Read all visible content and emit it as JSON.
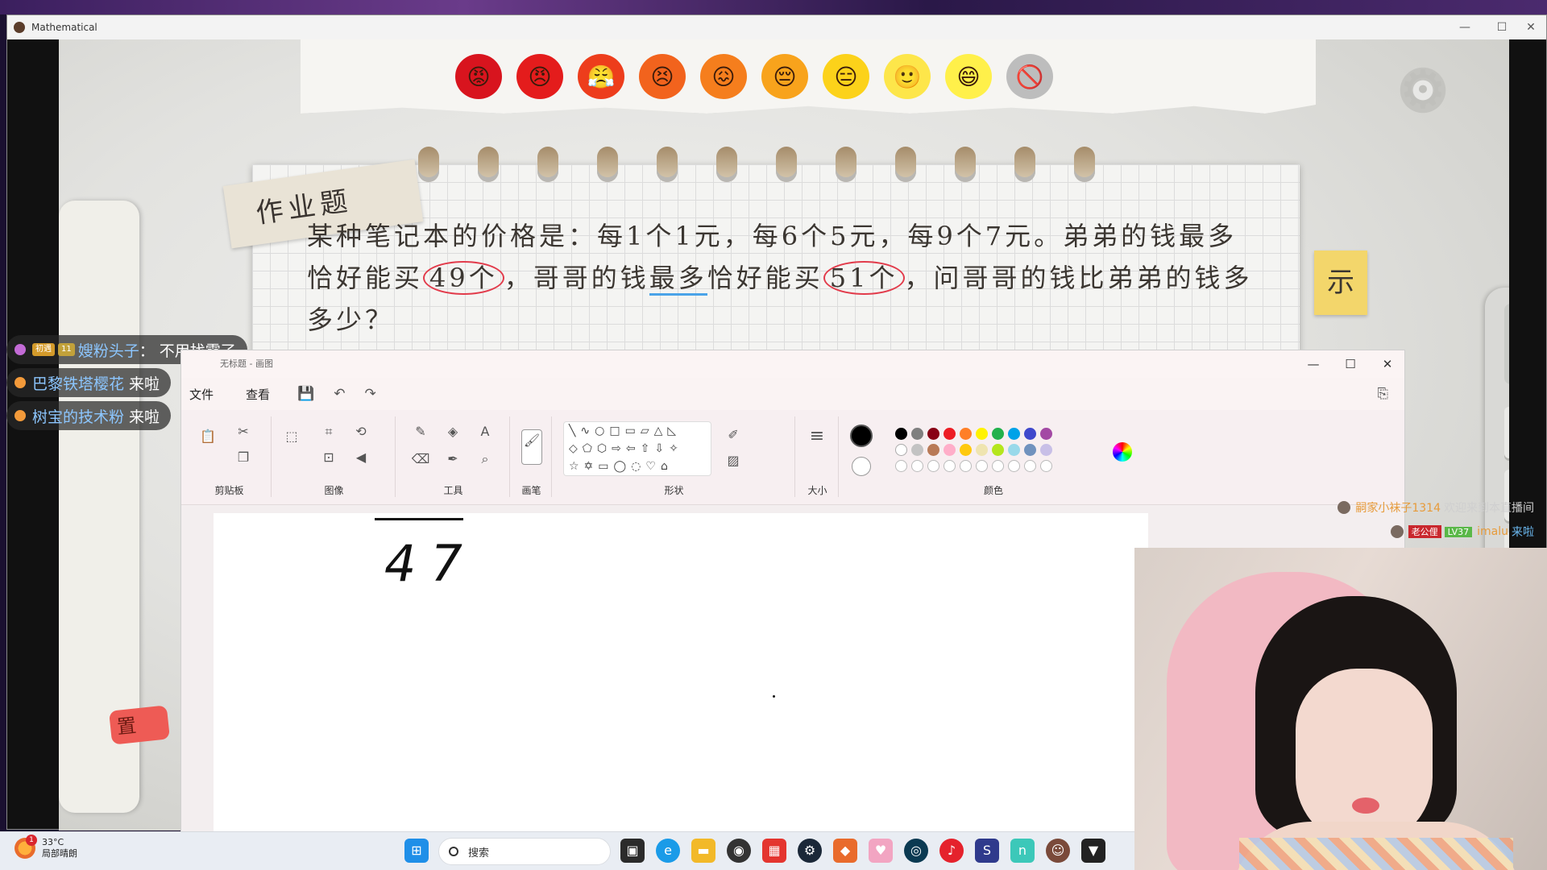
{
  "game": {
    "title": "Mathematical",
    "controls": [
      "—",
      "☐",
      "✕"
    ],
    "emojis": [
      {
        "face": "😡",
        "color": "#d8141e"
      },
      {
        "face": "😠",
        "color": "#e41c1c"
      },
      {
        "face": "😤",
        "color": "#ed3d1c"
      },
      {
        "face": "😣",
        "color": "#f2631d"
      },
      {
        "face": "😖",
        "color": "#f57e1d"
      },
      {
        "face": "😔",
        "color": "#f8a31c"
      },
      {
        "face": "😑",
        "color": "#fcd21a"
      },
      {
        "face": "🙂",
        "color": "#fde64a"
      },
      {
        "face": "😄",
        "color": "#fff04a"
      },
      {
        "face": "🚫",
        "color": "#bdbdbd"
      }
    ],
    "homework_tag": "作业题",
    "problem": {
      "line1": "某种笔记本的价格是：每1个1元，每6个5元，每9个7元。弟弟的钱最多",
      "line2_a": "恰好能买",
      "line2_circle1": "49个",
      "line2_b": "，哥哥的钱",
      "line2_underline": "最多",
      "line2_c": "恰好能买",
      "line2_circle2": "51个",
      "line2_d": "，问哥哥的钱比弟弟的钱多",
      "line3": "多少？"
    },
    "hint_label": "示",
    "stamp_label": "置",
    "calculator_keys": [
      "+",
      "7",
      "4"
    ]
  },
  "chat": [
    {
      "name": "嫂粉头子",
      "sep": "：",
      "msg": "不用找零了",
      "badge1": "初遇",
      "badge2": "11"
    },
    {
      "name": "巴黎铁塔樱花",
      "msg": "来啦"
    },
    {
      "name": "树宝的技术粉",
      "msg": "来啦"
    }
  ],
  "paint": {
    "title_text": "无标题 - 画图",
    "controls": [
      "—",
      "☐",
      "✕"
    ],
    "menu": [
      "文件",
      "查看"
    ],
    "quick": [
      "💾",
      "↶",
      "↷"
    ],
    "groups": {
      "clipboard": "剪贴板",
      "image": "图像",
      "tools": "工具",
      "brush": "画笔",
      "shapes": "形状",
      "size": "大小",
      "colors": "颜色"
    },
    "shapes_rows": [
      "╲∿○□▭▱△◺",
      "◇⬠⬡⇨⇦⇧⇩✧",
      "☆✡▭◯◌♡⌂"
    ],
    "palette_row1": [
      "#000000",
      "#7f7f7f",
      "#880015",
      "#ed1c24",
      "#ff7f27",
      "#fff200",
      "#22b14c",
      "#00a2e8",
      "#3f48cc",
      "#a349a4"
    ],
    "palette_row2": [
      "#ffffff",
      "#c3c3c3",
      "#b97a57",
      "#ffaec9",
      "#ffc90e",
      "#efe4b0",
      "#b5e61d",
      "#99d9ea",
      "#7092be",
      "#c8bfe7"
    ],
    "canvas_text": "47"
  },
  "viewer_join": [
    {
      "name": "嗣家小袜子1314",
      "msg": "欢迎来到本直播间"
    },
    {
      "badge": "老公俚",
      "level": "LV37",
      "name": "imalu",
      "msg": "来啦"
    }
  ],
  "taskbar": {
    "weather_temp": "33°C",
    "weather_desc": "局部晴朗",
    "weather_badge": "1",
    "search_placeholder": "搜索"
  }
}
